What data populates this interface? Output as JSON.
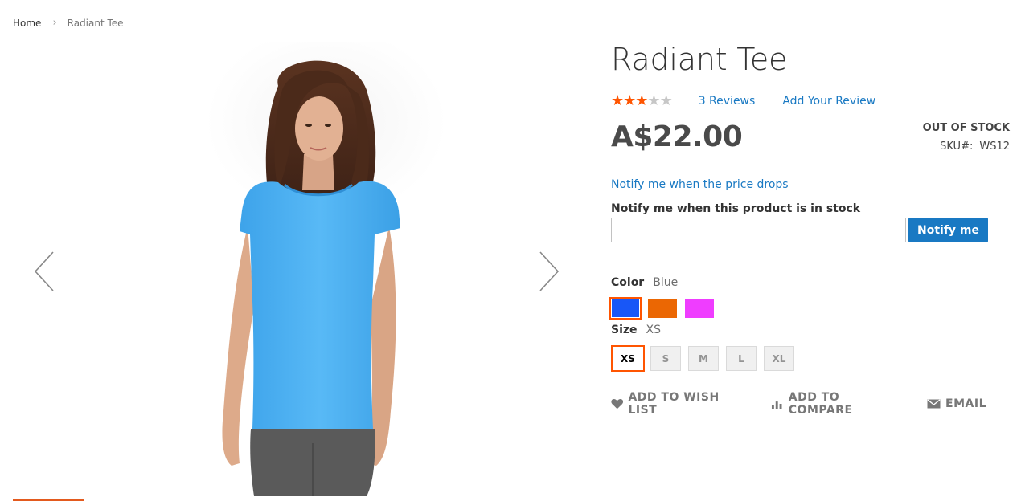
{
  "breadcrumb": {
    "home": "Home",
    "separator": "›",
    "current": "Radiant Tee"
  },
  "gallery": {
    "prev_icon": "chevron-left-icon",
    "next_icon": "chevron-right-icon",
    "active_color": "#e35a1e"
  },
  "product": {
    "title": "Radiant Tee",
    "rating_stars": 3,
    "rating_max": 5,
    "reviews_link": "3 Reviews",
    "add_review_link": "Add Your Review",
    "price": "A$22.00",
    "stock_status": "OUT OF STOCK",
    "sku_label": "SKU#:",
    "sku_value": "WS12"
  },
  "alerts": {
    "price_drop_link": "Notify me when the price drops",
    "stock_label": "Notify me when this product is in stock",
    "input_value": "",
    "notify_button": "Notify me"
  },
  "options": {
    "color_label": "Color",
    "color_selected": "Blue",
    "colors": [
      {
        "name": "Blue",
        "hex": "#1857f7",
        "selected": true
      },
      {
        "name": "Orange",
        "hex": "#eb6703",
        "selected": false
      },
      {
        "name": "Purple",
        "hex": "#ef3dff",
        "selected": false
      }
    ],
    "size_label": "Size",
    "size_selected": "XS",
    "sizes": [
      "XS",
      "S",
      "M",
      "L",
      "XL"
    ]
  },
  "actions": {
    "wishlist": "ADD TO WISH LIST",
    "compare": "ADD TO COMPARE",
    "email": "EMAIL"
  },
  "colors": {
    "link": "#1979c3",
    "accent": "#ff5501",
    "star_on": "#ff5501",
    "star_off": "#c7c7c7"
  }
}
